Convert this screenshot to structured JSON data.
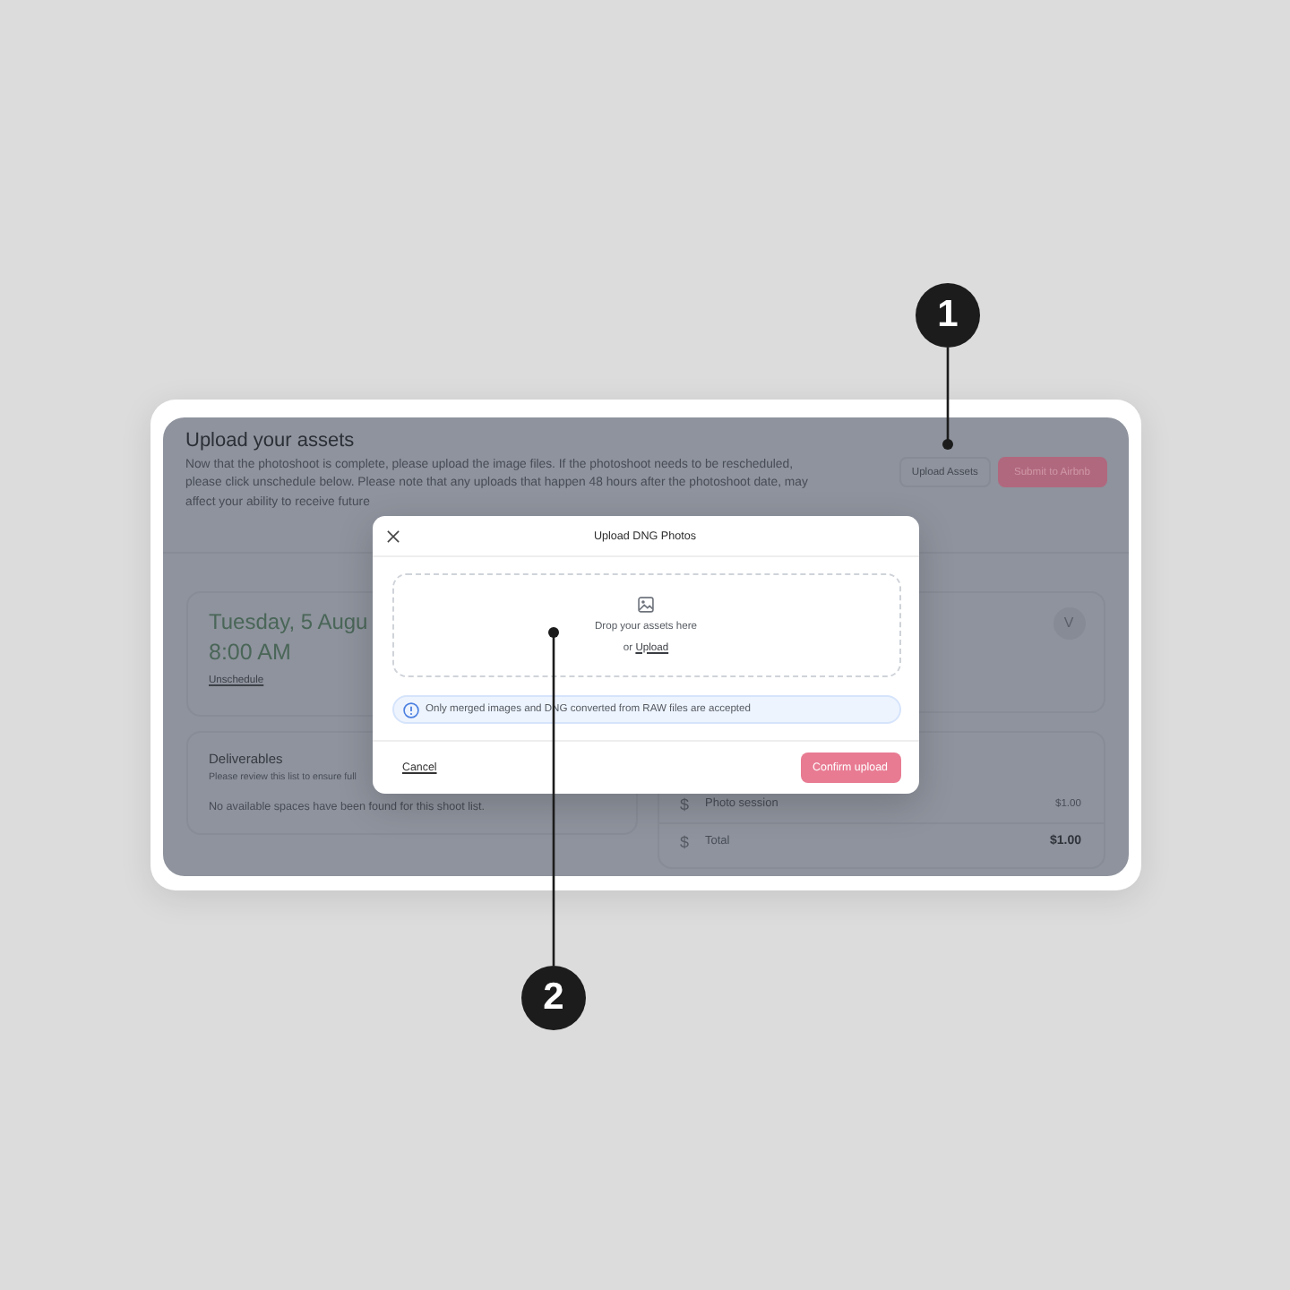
{
  "page": {
    "title": "Upload your assets",
    "description": "Now that the photoshoot is complete, please upload the image files. If the photoshoot needs to be rescheduled, please click unschedule below. Please note that any uploads that happen 48 hours after the photoshoot date, may affect your ability to receive future",
    "actions": [
      {
        "label": "Upload Assets",
        "kind": "secondary"
      },
      {
        "label": "Submit to Airbnb",
        "kind": "primary"
      }
    ]
  },
  "schedule_card": {
    "date": "Tuesday, 5 Augu",
    "time": "8:00 AM",
    "link": "Unschedule"
  },
  "assignee_card": {
    "avatar_initial": "V"
  },
  "deliverables_card": {
    "title": "Deliverables",
    "subtitle": "Please review this list to ensure full",
    "empty_message": "No available spaces have been found for this shoot list."
  },
  "pricing_card": {
    "rows": [
      {
        "symbol": "$",
        "label": "Photo session",
        "amount": "$1.00",
        "kind": "item"
      },
      {
        "symbol": "$",
        "label": "Total",
        "amount": "$1.00",
        "kind": "total"
      }
    ]
  },
  "modal": {
    "title": "Upload DNG Photos",
    "dropzone": {
      "prompt": "Drop your assets here",
      "or_text": "or",
      "link": "Upload"
    },
    "notice": "Only merged images and DNG converted from RAW files are accepted",
    "cancel": "Cancel",
    "confirm": "Confirm upload"
  },
  "callouts": [
    {
      "number": "1"
    },
    {
      "number": "2"
    }
  ]
}
